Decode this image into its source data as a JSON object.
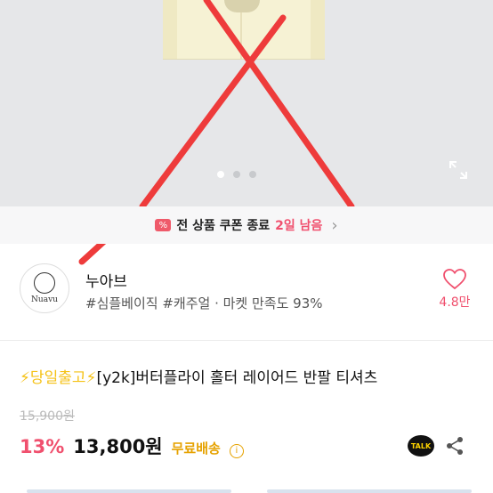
{
  "coupon": {
    "icon": "coupon-icon",
    "text": "전 상품 쿠폰 종료",
    "remain": "2일 남음"
  },
  "shop": {
    "logo_text": "Nuavu",
    "name": "누아브",
    "tags": "#심플베이직 #캐주얼 · 마켓 만족도 93%",
    "likes": "4.8만"
  },
  "product": {
    "title_prefix": "⚡당일출고⚡",
    "title_main": "[y2k]버터플라이 홀터 레이어드 반팔 티셔츠",
    "original_price": "15,900원",
    "discount": "13%",
    "price": "13,800원",
    "shipping": "무료배송"
  },
  "carousel": {
    "total": 3,
    "active": 0
  },
  "colors": {
    "accent": "#f0506e",
    "ship": "#e6a200",
    "cross": "#ee3b3b"
  },
  "icons": [
    "expand-icon",
    "heart-icon",
    "info-icon",
    "kakaotalk-icon",
    "share-icon",
    "chevron-right-icon"
  ]
}
